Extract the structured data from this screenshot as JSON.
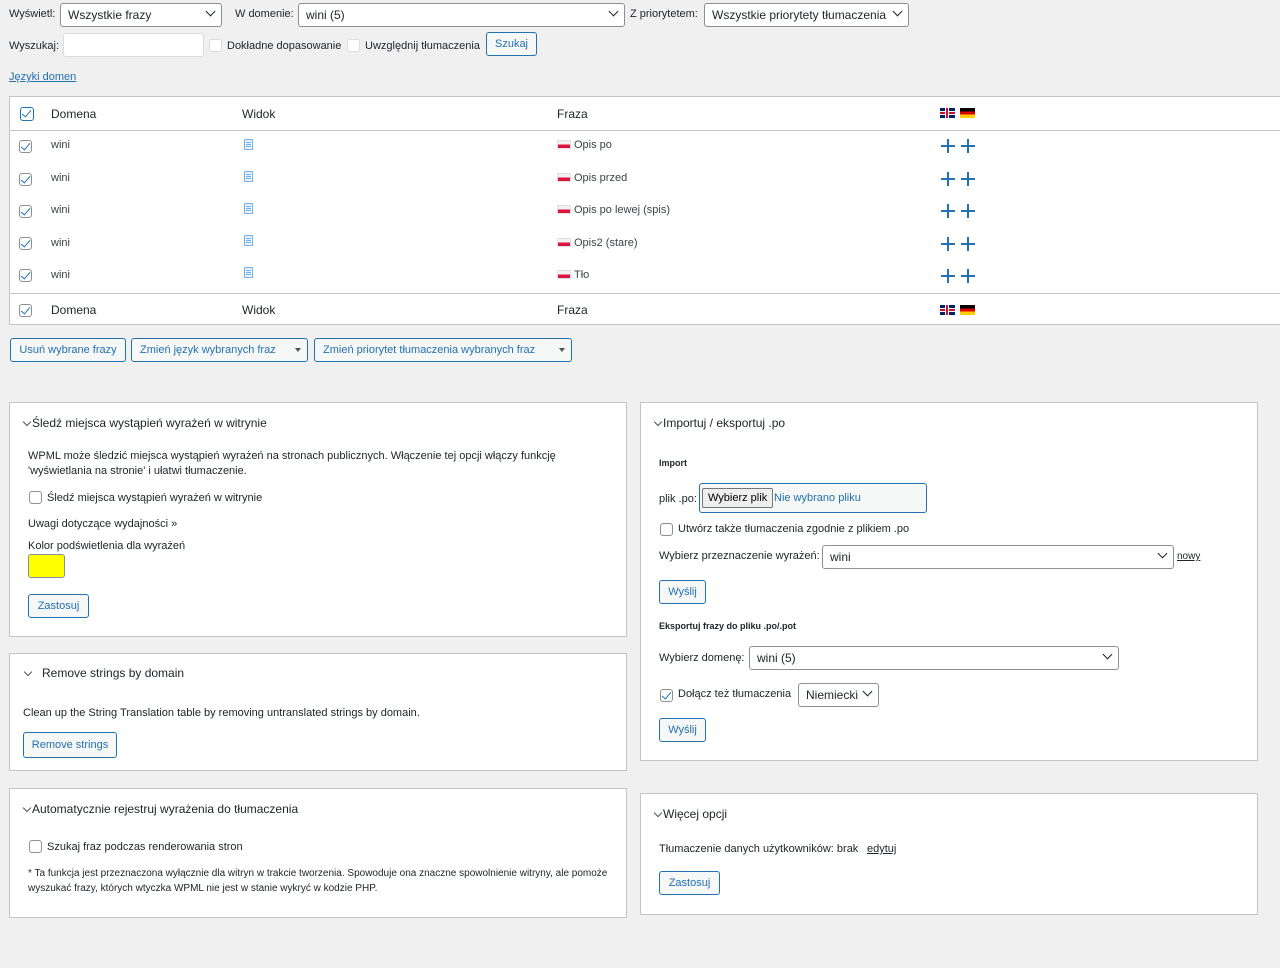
{
  "filters": {
    "display_label": "Wyświetl:",
    "display_value": "Wszystkie frazy",
    "domain_label": "W domenie:",
    "domain_value": "wini (5)",
    "priority_label": "Z priorytetem:",
    "priority_value": "Wszystkie priorytety tłumaczenia",
    "search_label": "Wyszukaj:",
    "search_value": "",
    "exact_label": "Dokładne dopasowanie",
    "include_translations_label": "Uwzględnij tłumaczenia",
    "search_button": "Szukaj",
    "domain_languages_link": "Języki domen"
  },
  "table": {
    "headers": {
      "domain": "Domena",
      "view": "Widok",
      "phrase": "Fraza"
    },
    "rows": [
      {
        "domain": "wini",
        "phrase": "Opis po"
      },
      {
        "domain": "wini",
        "phrase": "Opis przed"
      },
      {
        "domain": "wini",
        "phrase": "Opis po lewej (spis)"
      },
      {
        "domain": "wini",
        "phrase": "Opis2 (stare)"
      },
      {
        "domain": "wini",
        "phrase": "Tło"
      }
    ]
  },
  "bulk_actions": {
    "delete": "Usuń wybrane frazy",
    "change_language": "Zmień język wybranych fraz",
    "change_priority": "Zmień priorytet tłumaczenia wybranych fraz"
  },
  "track_panel": {
    "title": "Śledź miejsca wystąpień wyrażeń w witrynie",
    "description": "WPML może śledzić miejsca wystąpień wyrażeń na stronach publicznych. Włączenie tej opcji włączy funkcję 'wyświetlania na stronie' i ułatwi tłumaczenie.",
    "checkbox_label": "Śledź miejsca wystąpień wyrażeń w witrynie",
    "perf_link": "Uwagi dotyczące wydajności »",
    "color_label": "Kolor podświetlenia dla wyrażeń",
    "highlight_color": "#ffff00",
    "apply_button": "Zastosuj"
  },
  "remove_panel": {
    "title": "Remove strings by domain",
    "description": "Clean up the String Translation table by removing untranslated strings by domain.",
    "button": "Remove strings"
  },
  "auto_panel": {
    "title": "Automatycznie rejestruj wyrażenia do tłumaczenia",
    "checkbox_label": "Szukaj fraz podczas renderowania stron",
    "note": "* Ta funkcja jest przeznaczona wyłącznie dla witryn w trakcie tworzenia. Spowoduje ona znaczne spowolnienie witryny, ale pomoże wyszukać frazy, których wtyczka WPML nie jest w stanie wykryć w kodzie PHP."
  },
  "import_panel": {
    "title": "Importuj / eksportuj .po",
    "import_heading": "Import",
    "file_label": "plik .po:",
    "file_button": "Wybierz plik",
    "file_status": "Nie wybrano pliku",
    "create_translations_label": "Utwórz także tłumaczenia zgodnie z plikiem .po",
    "target_label": "Wybierz przeznaczenie wyrażeń:",
    "target_value": "wini",
    "new_link": "nowy",
    "send_button": "Wyślij",
    "export_heading": "Eksportuj frazy do pliku .po/.pot",
    "choose_domain_label": "Wybierz domenę:",
    "choose_domain_value": "wini (5)",
    "include_translations_label": "Dołącz też tłumaczenia",
    "language_value": "Niemiecki",
    "send_button_2": "Wyślij"
  },
  "more_panel": {
    "title": "Więcej opcji",
    "user_data_label": "Tłumaczenie danych użytkowników: brak",
    "edit_link": "edytuj",
    "apply_button": "Zastosuj"
  },
  "colors": {
    "accent": "#2271b1",
    "highlight": "#ffff00"
  }
}
